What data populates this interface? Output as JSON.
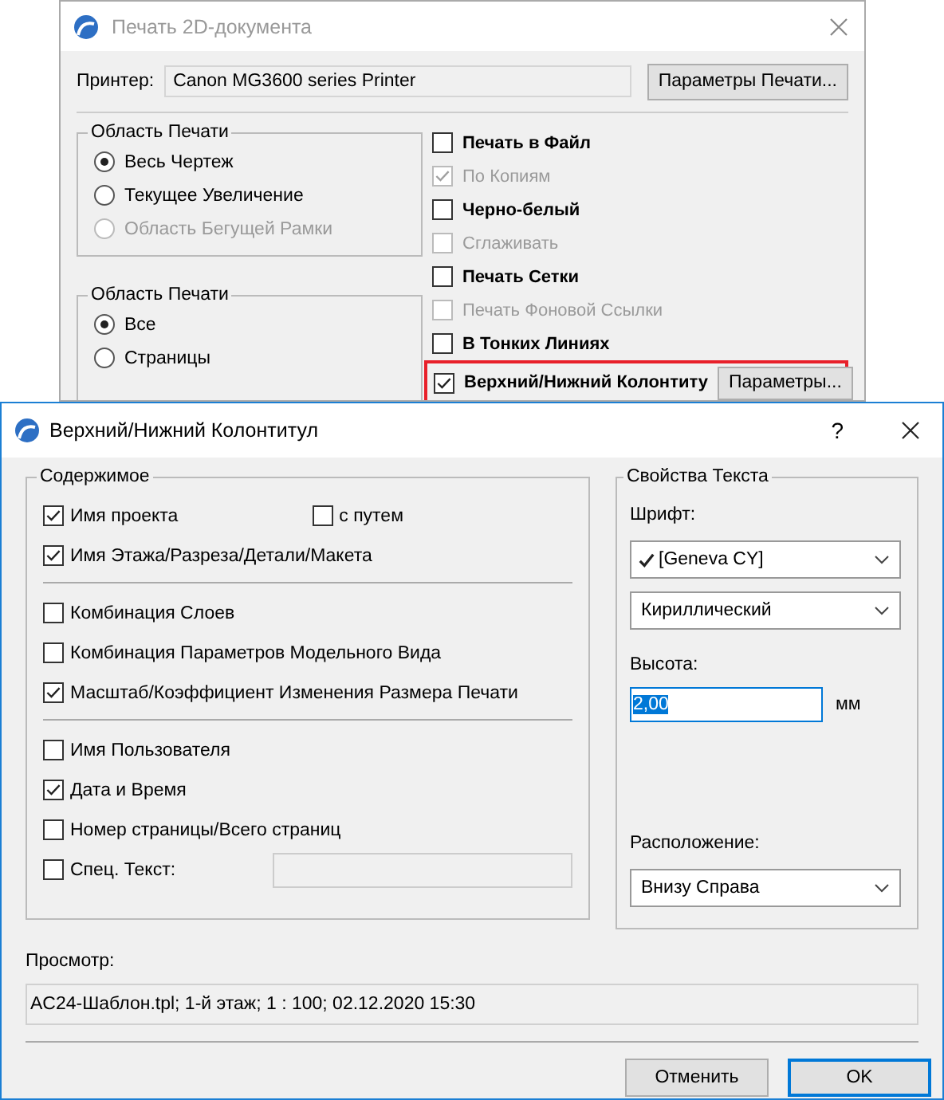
{
  "print_window": {
    "title": "Печать 2D-документа",
    "printer": {
      "label": "Принтер:",
      "value": "Canon MG3600 series Printer"
    },
    "printer_button": "Параметры Печати...",
    "area_group": {
      "title": "Область Печати",
      "options": [
        {
          "label": "Весь Чертеж",
          "selected": true,
          "disabled": false
        },
        {
          "label": "Текущее Увеличение",
          "selected": false,
          "disabled": false
        },
        {
          "label": "Область Бегущей Рамки",
          "selected": false,
          "disabled": true
        }
      ]
    },
    "range_group": {
      "title": "Область Печати",
      "options": [
        {
          "label": "Все",
          "selected": true,
          "disabled": false
        },
        {
          "label": "Страницы",
          "selected": false,
          "disabled": false
        }
      ]
    },
    "options": [
      {
        "label": "Печать в Файл",
        "checked": false,
        "disabled": false
      },
      {
        "label": "По Копиям",
        "checked": true,
        "disabled": true
      },
      {
        "label": "Черно-белый",
        "checked": false,
        "disabled": false
      },
      {
        "label": "Сглаживать",
        "checked": false,
        "disabled": true
      },
      {
        "label": "Печать Сетки",
        "checked": false,
        "disabled": false
      },
      {
        "label": "Печать Фоновой Ссылки",
        "checked": false,
        "disabled": true
      },
      {
        "label": "В Тонких Линиях",
        "checked": false,
        "disabled": false
      }
    ],
    "header_footer": {
      "label": "Верхний/Нижний Колонтиту",
      "checked": true,
      "button": "Параметры...",
      "highlighted": true
    }
  },
  "dialog": {
    "title": "Верхний/Нижний Колонтитул",
    "help": "?",
    "content_group": {
      "title": "Содержимое",
      "items": [
        {
          "kind": "checkbox",
          "label": "Имя проекта",
          "checked": true,
          "extra": {
            "label": "с путем",
            "checked": false
          }
        },
        {
          "kind": "checkbox",
          "label": "Имя Этажа/Разреза/Детали/Макета",
          "checked": true
        },
        {
          "kind": "divider"
        },
        {
          "kind": "checkbox",
          "label": "Комбинация Слоев",
          "checked": false
        },
        {
          "kind": "checkbox",
          "label": "Комбинация Параметров Модельного Вида",
          "checked": false
        },
        {
          "kind": "checkbox",
          "label": "Масштаб/Коэффициент Изменения Размера Печати",
          "checked": true
        },
        {
          "kind": "divider"
        },
        {
          "kind": "checkbox",
          "label": "Имя Пользователя",
          "checked": false
        },
        {
          "kind": "checkbox",
          "label": "Дата и Время",
          "checked": true
        },
        {
          "kind": "checkbox",
          "label": "Номер страницы/Всего страниц",
          "checked": false
        },
        {
          "kind": "checkbox_field",
          "label": "Спец. Текст:",
          "checked": false
        }
      ]
    },
    "text_group": {
      "title": "Свойства Текста",
      "font": {
        "label": "Шрифт:",
        "value": "[Geneva CY]",
        "available": true
      },
      "charset": {
        "value": "Кириллический"
      },
      "height": {
        "label": "Высота:",
        "value": "2,00",
        "selected": true,
        "unit": "мм"
      },
      "position": {
        "label": "Расположение:",
        "value": "Внизу Справа"
      }
    },
    "preview": {
      "label": "Просмотр:",
      "value": "AC24-Шаблон.tpl; 1-й этаж; 1 : 100; 02.12.2020 15:30"
    },
    "buttons": [
      {
        "label": "Отменить",
        "default": false
      },
      {
        "label": "OK",
        "default": true
      }
    ]
  }
}
